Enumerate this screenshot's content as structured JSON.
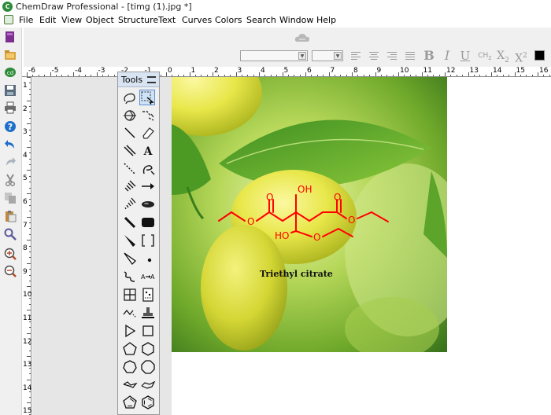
{
  "window": {
    "title": "ChemDraw Professional - [timg (1).jpg *]"
  },
  "menu": {
    "items": [
      "File",
      "Edit",
      "View",
      "Object",
      "Structure",
      "Text",
      "Curves",
      "Colors",
      "Search",
      "Window",
      "Help"
    ]
  },
  "format_toolbar": {
    "font_name": "",
    "font_size": "",
    "bold_label": "B",
    "italic_label": "I",
    "underline_label": "U",
    "formula_label": "CH2",
    "subscript_label": "X2",
    "superscript_label": "X2",
    "text_color": "#000000"
  },
  "ruler": {
    "horizontal": [
      "-6",
      "-5",
      "-4",
      "-3",
      "-2",
      "-1",
      "0",
      "1",
      "2",
      "3",
      "4",
      "5",
      "6",
      "7",
      "8",
      "9",
      "10",
      "11",
      "12",
      "13",
      "14",
      "15",
      "16"
    ],
    "vertical": [
      "1",
      "2",
      "3",
      "4",
      "5",
      "6",
      "7",
      "8",
      "9",
      "10",
      "11",
      "12",
      "13",
      "14",
      "15"
    ]
  },
  "tools_palette": {
    "title": "Tools"
  },
  "structure": {
    "color": "#ff0000",
    "atom_labels": {
      "o_ketone_left": "O",
      "o_ether_left": "O",
      "oh_top": "OH",
      "o_ketone_right": "O",
      "o_ether_right": "O",
      "ho_bottom": "HO",
      "o_bottom": "O"
    },
    "caption": "Triethyl citrate"
  }
}
